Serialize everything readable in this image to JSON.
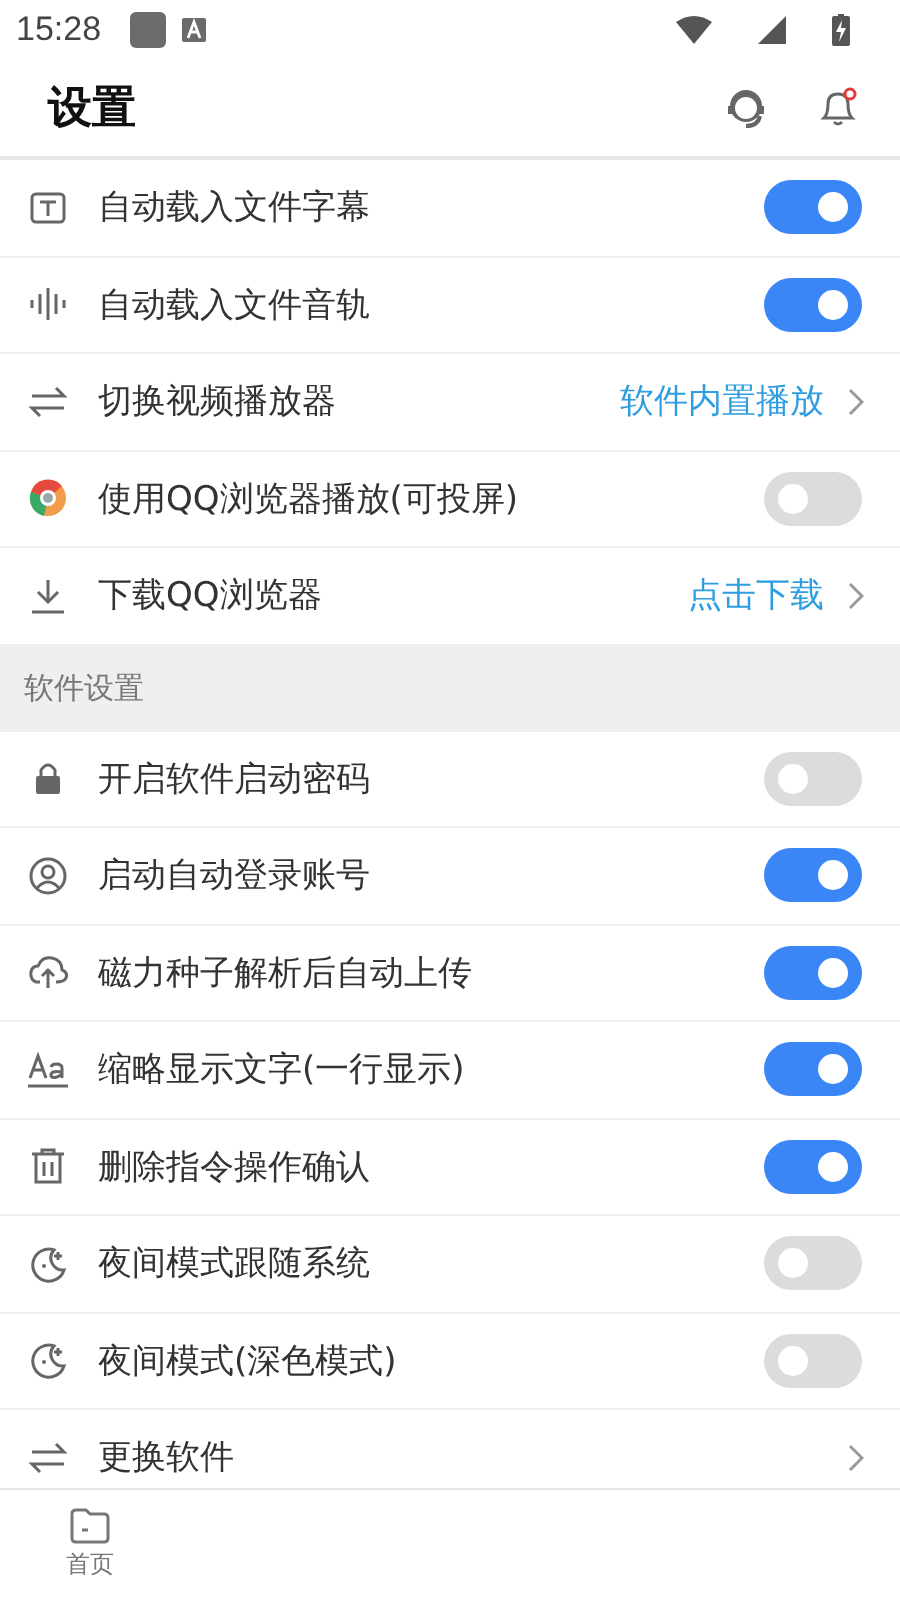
{
  "status_bar": {
    "time": "15:28"
  },
  "header": {
    "title": "设置",
    "notification_dot": true
  },
  "sections": [
    {
      "items": [
        {
          "kind": "toggle",
          "label": "自动载入文件字幕",
          "on": true
        },
        {
          "kind": "toggle",
          "label": "自动载入文件音轨",
          "on": true
        },
        {
          "kind": "link",
          "label": "切换视频播放器",
          "value": "软件内置播放"
        },
        {
          "kind": "toggle",
          "label": "使用QQ浏览器播放(可投屏)",
          "on": false
        },
        {
          "kind": "link",
          "label": "下载QQ浏览器",
          "value": "点击下载"
        }
      ]
    },
    {
      "header": "软件设置",
      "items": [
        {
          "kind": "toggle",
          "label": "开启软件启动密码",
          "on": false
        },
        {
          "kind": "toggle",
          "label": "启动自动登录账号",
          "on": true
        },
        {
          "kind": "toggle",
          "label": "磁力种子解析后自动上传",
          "on": true
        },
        {
          "kind": "toggle",
          "label": "缩略显示文字(一行显示)",
          "on": true
        },
        {
          "kind": "toggle",
          "label": "删除指令操作确认",
          "on": true
        },
        {
          "kind": "toggle",
          "label": "夜间模式跟随系统",
          "on": false
        },
        {
          "kind": "toggle",
          "label": "夜间模式(深色模式)",
          "on": false
        },
        {
          "kind": "link",
          "label": "更换软件"
        }
      ]
    }
  ],
  "bottom_nav": [
    {
      "label": "首页",
      "selected": false
    }
  ]
}
